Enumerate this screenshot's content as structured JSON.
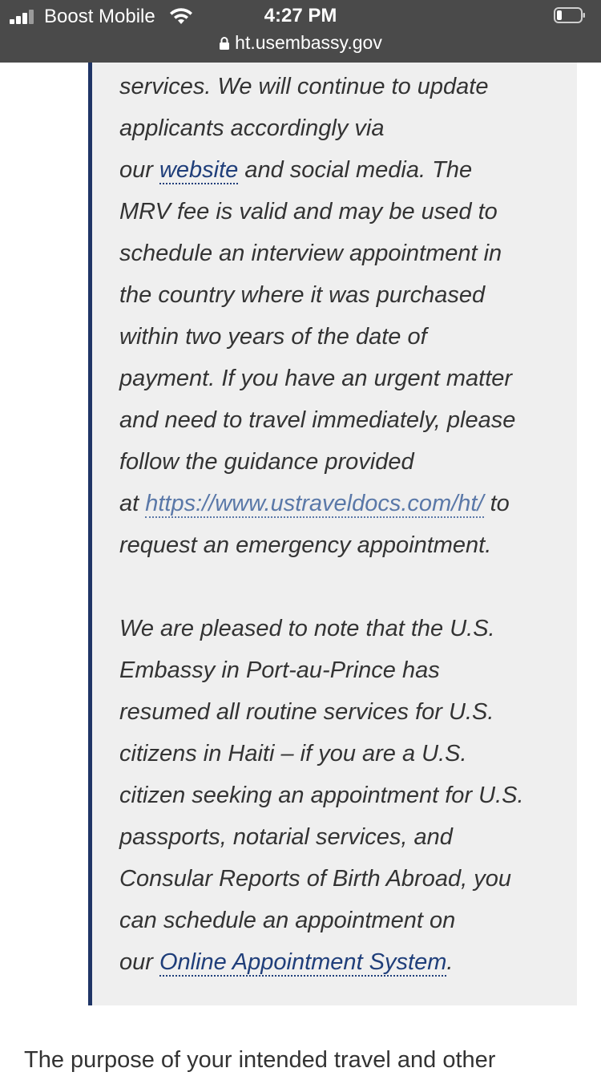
{
  "status_bar": {
    "carrier": "Boost Mobile",
    "time": "4:27 PM",
    "url": "ht.usembassy.gov",
    "icons": [
      "signal-icon",
      "wifi-icon",
      "lock-icon",
      "battery-icon"
    ]
  },
  "quote": {
    "p1": {
      "l1": "services.  We will continue to update",
      "l2": "applicants accordingly via",
      "l3_pre": "our ",
      "l3_link": "website",
      "l3_post": " and social media.  The",
      "l4": "MRV fee is valid and may be used to",
      "l5": "schedule an interview appointment in",
      "l6": "the country where it was purchased",
      "l7": "within two years of the date of",
      "l8": "payment.  If you have an urgent matter",
      "l9": "and need to travel immediately, please",
      "l10": "follow the guidance provided",
      "l11_pre": "at ",
      "l11_link": "https://www.ustraveldocs.com/ht/",
      "l11_post": " to",
      "l12": "request an emergency appointment."
    },
    "p2": {
      "l1": "We are pleased to note that the U.S.",
      "l2": "Embassy in Port-au-Prince has",
      "l3": "resumed all routine services for U.S.",
      "l4": "citizens in Haiti – if you are a U.S.",
      "l5": "citizen seeking an appointment for U.S.",
      "l6": "passports, notarial services, and",
      "l7": "Consular Reports of Birth Abroad, you",
      "l8": "can schedule an appointment on",
      "l9_pre": "our ",
      "l9_link": "Online Appointment System",
      "l9_post": "."
    }
  },
  "bottom_text": "The purpose of your intended travel and other",
  "colors": {
    "status_bar_bg": "#4a4a4a",
    "quote_bg": "#efefef",
    "quote_border": "#1f3566",
    "link": "#1f3e7a"
  }
}
